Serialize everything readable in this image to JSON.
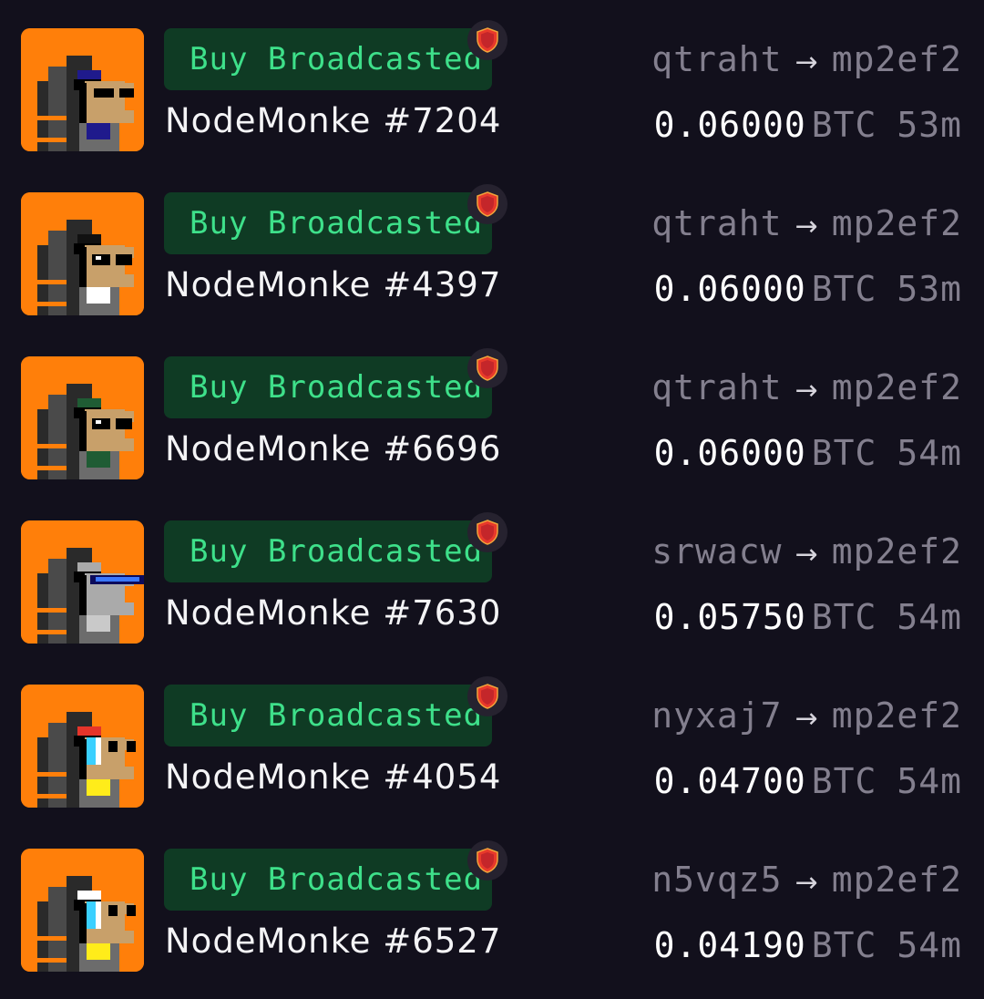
{
  "activity": {
    "items": [
      {
        "status": "Buy Broadcasted",
        "name": "NodeMonke #7204",
        "from": "qtraht",
        "to": "mp2ef2",
        "amount": "0.06000",
        "unit": "BTC",
        "age": "53m",
        "avatar": {
          "accessory": "#1f1a8c",
          "hat": "#1f1a8c",
          "face": "#c8a06a",
          "eyes": "none-visor"
        }
      },
      {
        "status": "Buy Broadcasted",
        "name": "NodeMonke #4397",
        "from": "qtraht",
        "to": "mp2ef2",
        "amount": "0.06000",
        "unit": "BTC",
        "age": "53m",
        "avatar": {
          "accessory": "#ffffff",
          "hat": "#111111",
          "face": "#c8a06a",
          "eyes": "sunglasses"
        }
      },
      {
        "status": "Buy Broadcasted",
        "name": "NodeMonke #6696",
        "from": "qtraht",
        "to": "mp2ef2",
        "amount": "0.06000",
        "unit": "BTC",
        "age": "54m",
        "avatar": {
          "accessory": "#1f5c34",
          "hat": "#1f5c34",
          "face": "#c8a06a",
          "eyes": "sunglasses"
        }
      },
      {
        "status": "Buy Broadcasted",
        "name": "NodeMonke #7630",
        "from": "srwacw",
        "to": "mp2ef2",
        "amount": "0.05750",
        "unit": "BTC",
        "age": "54m",
        "avatar": {
          "accessory": "#c9c9c9",
          "hat": "#aaaaaa",
          "face": "#aaaaaa",
          "eyes": "blue-visor"
        }
      },
      {
        "status": "Buy Broadcasted",
        "name": "NodeMonke #4054",
        "from": "nyxaj7",
        "to": "mp2ef2",
        "amount": "0.04700",
        "unit": "BTC",
        "age": "54m",
        "avatar": {
          "accessory": "#ffec1a",
          "hat": "#e5342a",
          "face": "#c8a06a",
          "eyes": "rainbow"
        }
      },
      {
        "status": "Buy Broadcasted",
        "name": "NodeMonke #6527",
        "from": "n5vqz5",
        "to": "mp2ef2",
        "amount": "0.04190",
        "unit": "BTC",
        "age": "54m",
        "avatar": {
          "accessory": "#ffec1a",
          "hat": "#ffffff",
          "face": "#c8a06a",
          "eyes": "rainbow"
        }
      }
    ]
  },
  "colors": {
    "background": "#12101c",
    "thumb_bg": "#ff7f0a",
    "badge_bg": "#0f3b24",
    "badge_text": "#3ee08a",
    "muted_text": "#837f8e",
    "shield": "#e8392b"
  },
  "icons": {
    "verified": "shield-icon",
    "transfer": "arrow-right-icon"
  }
}
